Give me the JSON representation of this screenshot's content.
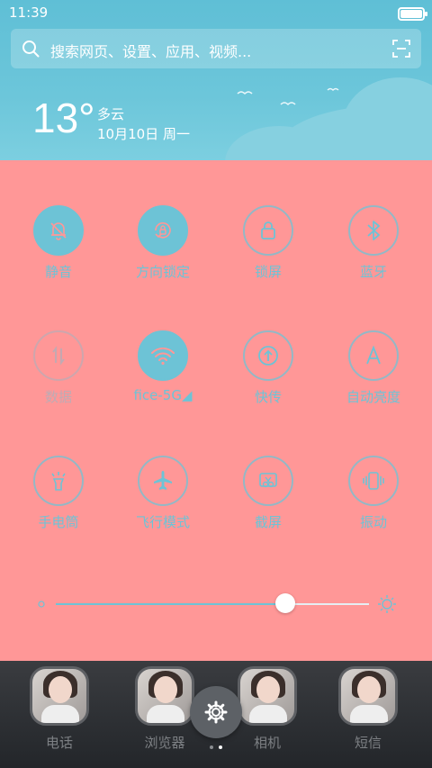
{
  "status_bar": {
    "time": "11:39"
  },
  "search": {
    "placeholder": "搜索网页、设置、应用、视频..."
  },
  "weather": {
    "temperature": "13°",
    "condition": "多云",
    "date": "10月10日 周一"
  },
  "toggles": [
    {
      "label": "静音",
      "icon": "bell-off-icon",
      "state": "on"
    },
    {
      "label": "方向锁定",
      "icon": "rotation-lock-icon",
      "state": "on"
    },
    {
      "label": "锁屏",
      "icon": "lock-icon",
      "state": "off"
    },
    {
      "label": "蓝牙",
      "icon": "bluetooth-icon",
      "state": "off"
    },
    {
      "label": "数据",
      "icon": "mobile-data-icon",
      "state": "disabled"
    },
    {
      "label": "fice-5G◢",
      "icon": "wifi-icon",
      "state": "on"
    },
    {
      "label": "快传",
      "icon": "upload-icon",
      "state": "off"
    },
    {
      "label": "自动亮度",
      "icon": "auto-brightness-icon",
      "state": "off"
    },
    {
      "label": "手电筒",
      "icon": "flashlight-icon",
      "state": "off"
    },
    {
      "label": "飞行模式",
      "icon": "airplane-icon",
      "state": "off"
    },
    {
      "label": "截屏",
      "icon": "screenshot-icon",
      "state": "off"
    },
    {
      "label": "振动",
      "icon": "vibrate-icon",
      "state": "off"
    }
  ],
  "brightness": {
    "level": 0.8
  },
  "dock": [
    {
      "label": "电话",
      "icon": "phone-app-icon"
    },
    {
      "label": "浏览器",
      "icon": "browser-app-icon"
    },
    {
      "label": "相机",
      "icon": "camera-app-icon"
    },
    {
      "label": "短信",
      "icon": "messages-app-icon"
    }
  ],
  "colors": {
    "panel": "#ff9797",
    "accent": "#6dc3d6",
    "sky": "#5fbfd6"
  }
}
